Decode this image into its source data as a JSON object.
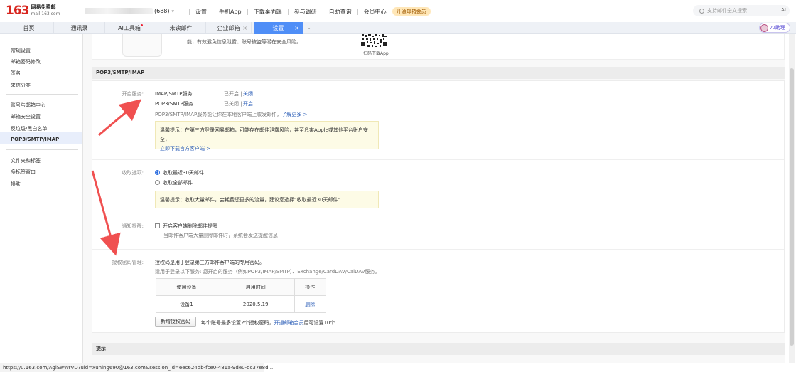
{
  "header": {
    "logo_number": "163",
    "logo_name": "网易免费邮",
    "logo_domain": "mail.163.com",
    "account_count": "(688)",
    "nav": [
      "设置",
      "手机App",
      "下载桌面端",
      "参与调研",
      "自助查询",
      "会员中心"
    ],
    "vip_badge": "开通邮箱会员",
    "search_placeholder": "支持邮件全文搜索",
    "search_ai": "AI"
  },
  "tabs": [
    {
      "label": "首页"
    },
    {
      "label": "通讯录"
    },
    {
      "label": "AI工具箱"
    },
    {
      "label": "未读邮件"
    },
    {
      "label": "企业邮箱"
    },
    {
      "label": "设置"
    }
  ],
  "close_glyph": "×",
  "more_glyph": "⌄",
  "ai_assistant": "AI助理",
  "sidebar": {
    "group1": [
      "常规设置",
      "邮箱密码修改",
      "签名",
      "来信分类"
    ],
    "group2": [
      "账号与邮箱中心",
      "邮箱安全设置",
      "反垃圾/黑白名单",
      "POP3/SMTP/IMAP"
    ],
    "group3": [
      "文件夹和标签",
      "多标签窗口",
      "换肤"
    ]
  },
  "top_card": {
    "text": "能，有效避免信息泄露、账号被盗等潜在安全风险。",
    "qr_label": "扫码下载App"
  },
  "section_title": "POP3/SMTP/IMAP",
  "enable_service": {
    "label": "开启服务:",
    "rows": [
      {
        "name": "IMAP/SMTP服务",
        "state": "已开启 |",
        "action": "关闭"
      },
      {
        "name": "POP3/SMTP服务",
        "state": "已关闭 |",
        "action": "开启"
      }
    ],
    "desc": "POP3/SMTP/IMAP服务能让你在本地客户端上收发邮件，",
    "learn_more": "了解更多 >",
    "tip_line1": "温馨提示：在第三方登录网易邮箱，可能存在邮件泄露风险，甚至危害Apple或其他平台账户安全，",
    "tip_link": "立即下载官方客户端 >"
  },
  "receive": {
    "label": "收取选项:",
    "opt1": "收取最近30天邮件",
    "opt2": "收取全部邮件",
    "tip": "温馨提示：收取大量邮件，会耗费您更多的流量，建议您选择“收取最近30天邮件”"
  },
  "notify": {
    "label": "通知提醒:",
    "checkbox": "开启客户端删除邮件提醒",
    "desc": "当邮件客户端大量删除邮件时，系统会发送提醒信息"
  },
  "auth": {
    "label": "授权密码管理:",
    "line1": "授权码是用于登录第三方邮件客户端的专用密码。",
    "line2": "适用于登录以下服务: 您开启的服务（例如POP3/IMAP/SMTP）、Exchange/CardDAV/CalDAV服务。",
    "headers": [
      "使用设备",
      "启用时间",
      "操作"
    ],
    "row": {
      "device": "设备1",
      "date": "2020.5.19",
      "action": "删除"
    },
    "button": "新增授权密码",
    "note_prefix": "每个账号最多设置2个授权密码，",
    "note_link": "开通邮箱会员",
    "note_suffix": "后可设置10个"
  },
  "hint_section": "提示",
  "status_url": "https://u.163.com/AgiSwWrVD?uid=xuning690@163.com&session_id=eec624db-fce0-481a-9de0-dc37e8d...",
  "colors": {
    "accent": "#4f8ef7",
    "arrow": "#f05050",
    "link": "#2d5fb8"
  }
}
